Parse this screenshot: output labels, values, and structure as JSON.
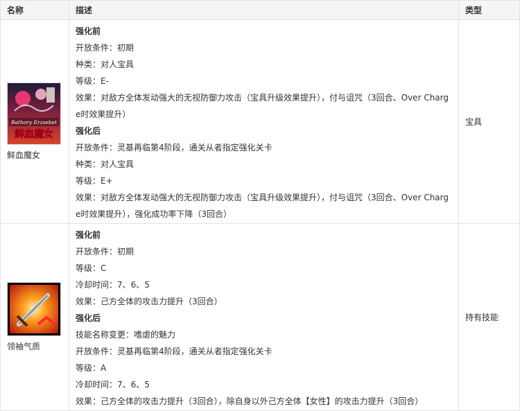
{
  "headers": [
    "名称",
    "描述",
    "类型"
  ],
  "rows": [
    {
      "name": "鲜血魔女",
      "icon": "noble-phantasm-card-icon",
      "type": "宝具",
      "before": {
        "heading": "强化前",
        "lines": [
          "开放条件：初期",
          "种类：对人宝具",
          "等级：E-"
        ],
        "effect": "效果：对敌方全体发动强大的无视防御力攻击（宝具升级效果提升），付与诅咒（3回合、Over Charge时效果提升）"
      },
      "after": {
        "heading": "强化后",
        "lines": [
          "开放条件：灵基再临第4阶段，通关从者指定强化关卡",
          "种类：对人宝具",
          "等级：E+"
        ],
        "effect": "效果：对敌方全体发动强大的无视防御力攻击（宝具升级效果提升），付与诅咒（3回合、Over Charge时效果提升），强化成功率下降（3回合）"
      }
    },
    {
      "name": "领袖气质",
      "icon": "sword-skill-icon",
      "type": "持有技能",
      "before": {
        "heading": "强化前",
        "lines": [
          "开放条件：初期",
          "等级：C",
          "冷却时间：7、6、5",
          "效果：己方全体的攻击力提升（3回合）"
        ]
      },
      "after": {
        "heading": "强化后",
        "lines": [
          "技能名称变更：嗜虐的魅力",
          "开放条件：灵基再临第4阶段，通关从者指定强化关卡",
          "等级：A",
          "冷却时间：7、6、5",
          "效果：己方全体的攻击力提升（3回合），除自身以外己方全体【女性】的攻击力提升（3回合）"
        ]
      }
    }
  ],
  "icon_text": {
    "np_en": "Bathory Erzsebet",
    "np_cn": "鲜血魔女"
  }
}
